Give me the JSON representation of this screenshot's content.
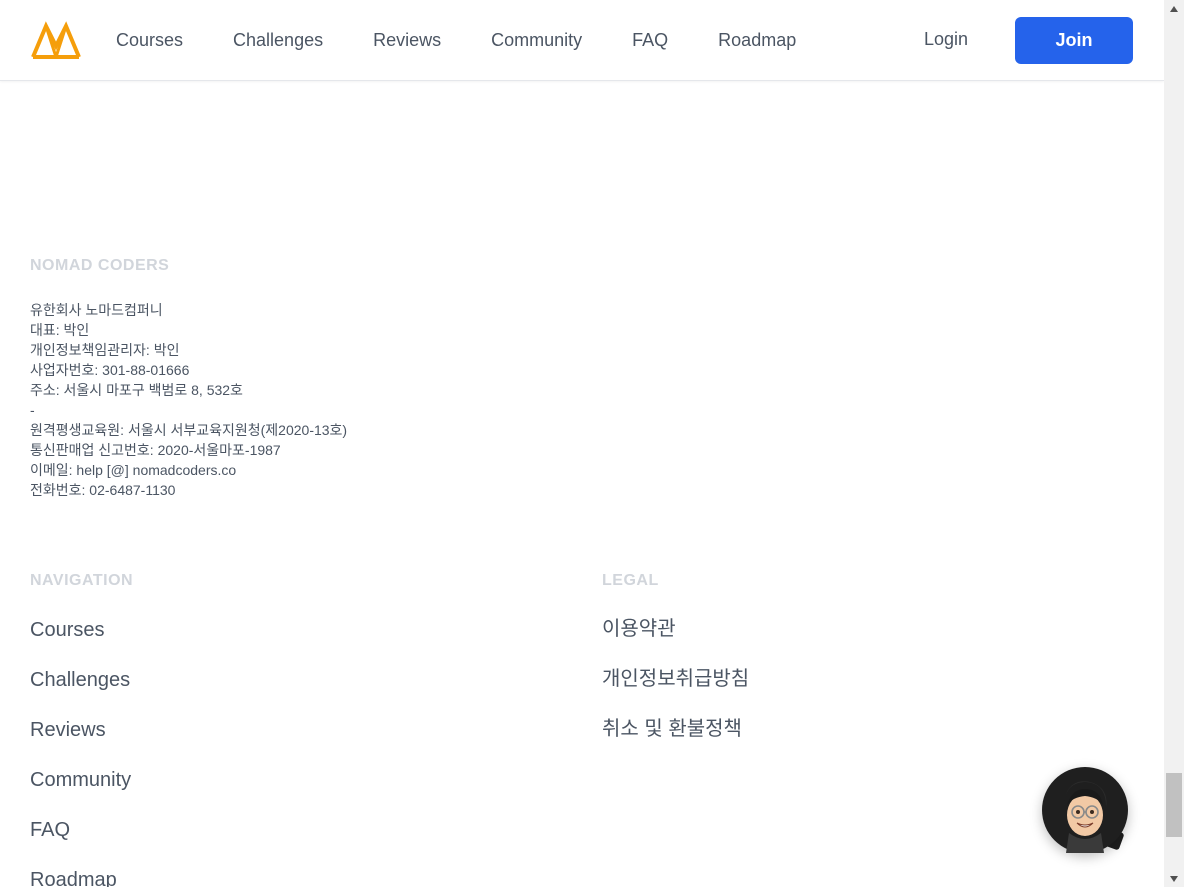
{
  "header": {
    "nav": [
      "Courses",
      "Challenges",
      "Reviews",
      "Community",
      "FAQ",
      "Roadmap"
    ],
    "login_label": "Login",
    "join_label": "Join",
    "brand_color": "#2563eb",
    "logo_color": "#f59e0b"
  },
  "company": {
    "title": "NOMAD CODERS",
    "lines": [
      "유한회사 노마드컴퍼니",
      "대표: 박인",
      "개인정보책임관리자: 박인",
      "사업자번호: 301-88-01666",
      "주소: 서울시 마포구 백범로 8, 532호",
      "-",
      "원격평생교육원: 서울시 서부교육지원청(제2020-13호)",
      "통신판매업 신고번호: 2020-서울마포-1987",
      "이메일: help [@] nomadcoders.co",
      "전화번호: 02-6487-1130"
    ]
  },
  "navigation": {
    "title": "NAVIGATION",
    "items": [
      "Courses",
      "Challenges",
      "Reviews",
      "Community",
      "FAQ",
      "Roadmap"
    ]
  },
  "legal": {
    "title": "LEGAL",
    "items": [
      "이용약관",
      "개인정보취급방침",
      "취소 및 환불정책"
    ]
  },
  "icons": {
    "logo": "nomad-coders-logo",
    "chat": "chat-avatar-icon"
  }
}
